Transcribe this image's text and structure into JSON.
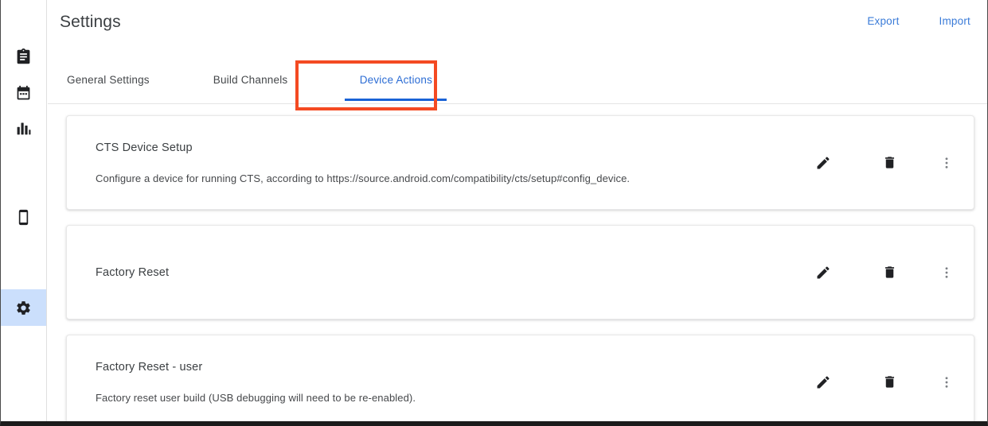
{
  "app": {
    "title": "Settings"
  },
  "sidebar": {
    "items": [
      {
        "name": "clipboard",
        "icon": "clipboard-icon",
        "active": false
      },
      {
        "name": "calendar",
        "icon": "calendar-icon",
        "active": false
      },
      {
        "name": "analytics",
        "icon": "bar-chart-icon",
        "active": false
      },
      {
        "name": "devices",
        "icon": "phone-icon",
        "active": false
      },
      {
        "name": "settings",
        "icon": "gear-icon",
        "active": true
      }
    ]
  },
  "header": {
    "title": "Settings",
    "export_label": "Export",
    "import_label": "Import"
  },
  "tabs": [
    {
      "label": "General Settings",
      "active": false
    },
    {
      "label": "Build Channels",
      "active": false
    },
    {
      "label": "Device Actions",
      "active": true
    }
  ],
  "highlight": {
    "target": "Device Actions",
    "color": "#f44a22"
  },
  "device_actions": [
    {
      "title": "CTS Device Setup",
      "description": "Configure a device for running CTS, according to https://source.android.com/compatibility/cts/setup#config_device.",
      "edit_label": "Edit",
      "delete_label": "Delete",
      "more_label": "More options"
    },
    {
      "title": "Factory Reset",
      "description": "",
      "edit_label": "Edit",
      "delete_label": "Delete",
      "more_label": "More options"
    },
    {
      "title": "Factory Reset - user",
      "description": "Factory reset user build (USB debugging will need to be re-enabled).",
      "edit_label": "Edit",
      "delete_label": "Delete",
      "more_label": "More options"
    }
  ],
  "colors": {
    "link_blue": "#3a7bd8",
    "tab_active_blue": "#2b6cd4",
    "tab_indicator": "#1a63d6",
    "rail_active_bg": "#cbdffc",
    "highlight_orange": "#f44a22",
    "text_primary": "#3c4043",
    "card_border": "#e8e8e8"
  }
}
